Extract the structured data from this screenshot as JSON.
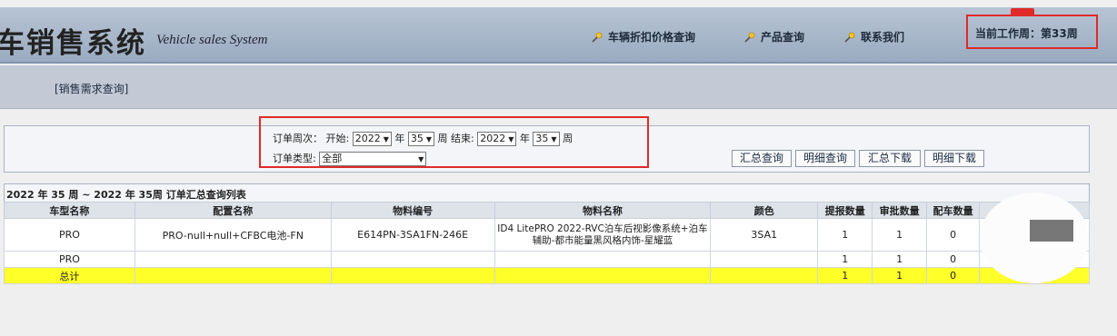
{
  "header": {
    "title": "车销售系统",
    "subtitle": "Vehicle sales System",
    "nav": [
      "车辆折扣价格查询",
      "产品查询",
      "联系我们"
    ],
    "current_week": "当前工作周：第33周"
  },
  "breadcrumb": "[销售需求查询]",
  "filter": {
    "week_label": "订单周次：",
    "start_label": "开始:",
    "start_year": "2022",
    "year_unit": "年",
    "start_week": "35",
    "week_unit": "周",
    "end_label": "结束:",
    "end_year": "2022",
    "end_week": "35",
    "type_label": "订单类型:",
    "type_value": "全部"
  },
  "buttons": [
    "汇总查询",
    "明细查询",
    "汇总下载",
    "明细下载"
  ],
  "results": {
    "title": "2022 年 35 周 ~ 2022 年 35周 订单汇总查询列表",
    "columns": [
      "车型名称",
      "配置名称",
      "物料编号",
      "物料名称",
      "颜色",
      "提报数量",
      "审批数量",
      "配车数量"
    ],
    "rows": [
      [
        "PRO",
        "PRO-null+null+CFBC电池-FN",
        "E614PN-3SA1FN-246E",
        "ID4 LitePRO 2022-RVC泊车后视影像系统+泊车辅助-都市能量黑风格内饰-星耀蓝",
        "3SA1",
        "1",
        "1",
        "0"
      ],
      [
        "PRO",
        "",
        "",
        "",
        "",
        "1",
        "1",
        "0"
      ],
      [
        "总计",
        "",
        "",
        "",
        "",
        "1",
        "1",
        "0"
      ]
    ]
  },
  "icons": {
    "nav_icon": "key-icon"
  },
  "colors": {
    "highlight_red": "#e02a2a",
    "total_yellow": "#ffff2a"
  }
}
